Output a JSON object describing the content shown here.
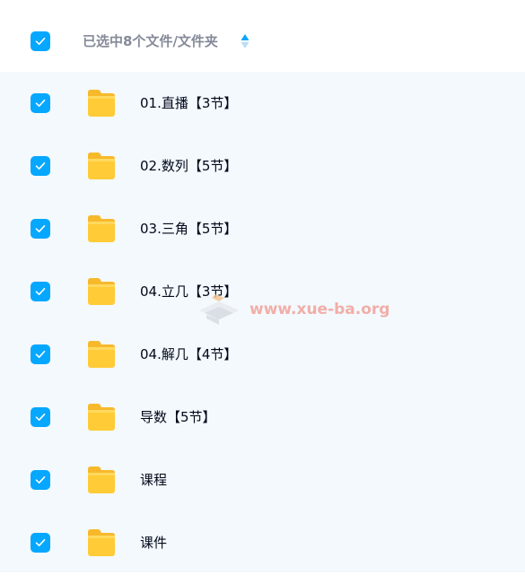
{
  "header": {
    "selected_label": "已选中8个文件/文件夹",
    "checked": true
  },
  "files": [
    {
      "name": "01.直播【3节】",
      "type": "folder",
      "checked": true
    },
    {
      "name": "02.数列【5节】",
      "type": "folder",
      "checked": true
    },
    {
      "name": "03.三角【5节】",
      "type": "folder",
      "checked": true
    },
    {
      "name": "04.立几【3节】",
      "type": "folder",
      "checked": true
    },
    {
      "name": "04.解几【4节】",
      "type": "folder",
      "checked": true
    },
    {
      "name": "导数【5节】",
      "type": "folder",
      "checked": true
    },
    {
      "name": "课程",
      "type": "folder",
      "checked": true
    },
    {
      "name": "课件",
      "type": "folder",
      "checked": true
    }
  ],
  "watermark": {
    "text": "www.xue-ba.org"
  },
  "colors": {
    "accent": "#06a7ff",
    "list_background": "#f3f9fd",
    "header_text": "#858a99",
    "row_text": "#03081a",
    "folder": "#ffcb37"
  },
  "icons": {
    "checkbox": "checkmark-icon",
    "folder": "folder-icon",
    "sort": "sort-icon"
  }
}
